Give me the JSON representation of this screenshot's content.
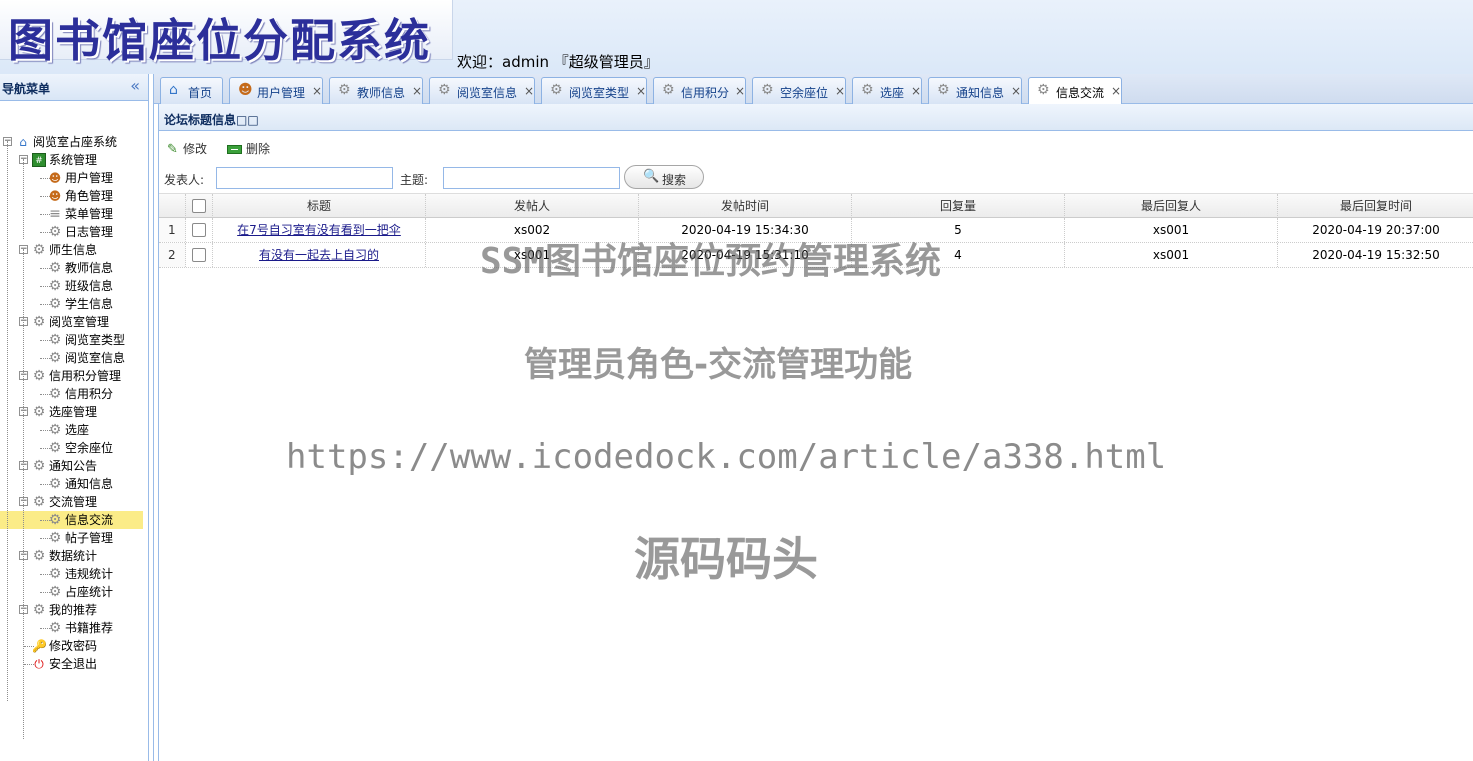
{
  "header": {
    "logo_text": "图书馆座位分配系统",
    "welcome": "欢迎：admin 『超级管理员』"
  },
  "sidebar": {
    "title": "导航菜单",
    "collapse_icon": "«",
    "tree": [
      {
        "label": "阅览室占座系统",
        "icon": "home-icon"
      },
      {
        "label": "系统管理",
        "icon": "grid-icon"
      },
      {
        "label": "用户管理",
        "icon": "user-icon"
      },
      {
        "label": "角色管理",
        "icon": "users-icon"
      },
      {
        "label": "菜单管理",
        "icon": "menu-icon"
      },
      {
        "label": "日志管理",
        "icon": "gear-icon"
      },
      {
        "label": "师生信息",
        "icon": "gear-icon"
      },
      {
        "label": "教师信息",
        "icon": "gear-icon"
      },
      {
        "label": "班级信息",
        "icon": "gear-icon"
      },
      {
        "label": "学生信息",
        "icon": "gear-icon"
      },
      {
        "label": "阅览室管理",
        "icon": "gear-icon"
      },
      {
        "label": "阅览室类型",
        "icon": "gear-icon"
      },
      {
        "label": "阅览室信息",
        "icon": "gear-icon"
      },
      {
        "label": "信用积分管理",
        "icon": "gear-icon"
      },
      {
        "label": "信用积分",
        "icon": "gear-icon"
      },
      {
        "label": "选座管理",
        "icon": "gear-icon"
      },
      {
        "label": "选座",
        "icon": "gear-icon"
      },
      {
        "label": "空余座位",
        "icon": "gear-icon"
      },
      {
        "label": "通知公告",
        "icon": "gear-icon"
      },
      {
        "label": "通知信息",
        "icon": "gear-icon"
      },
      {
        "label": "交流管理",
        "icon": "gear-icon"
      },
      {
        "label": "信息交流",
        "icon": "gear-icon"
      },
      {
        "label": "帖子管理",
        "icon": "gear-icon"
      },
      {
        "label": "数据统计",
        "icon": "gear-icon"
      },
      {
        "label": "违规统计",
        "icon": "gear-icon"
      },
      {
        "label": "占座统计",
        "icon": "gear-icon"
      },
      {
        "label": "我的推荐",
        "icon": "gear-icon"
      },
      {
        "label": "书籍推荐",
        "icon": "gear-icon"
      },
      {
        "label": "修改密码",
        "icon": "key-icon"
      },
      {
        "label": "安全退出",
        "icon": "exit-icon"
      }
    ]
  },
  "tabs": [
    {
      "label": "首页",
      "icon": "home-icon",
      "closable": false
    },
    {
      "label": "用户管理",
      "icon": "user-icon",
      "closable": true
    },
    {
      "label": "教师信息",
      "icon": "gear-icon",
      "closable": true
    },
    {
      "label": "阅览室信息",
      "icon": "gear-icon",
      "closable": true
    },
    {
      "label": "阅览室类型",
      "icon": "gear-icon",
      "closable": true
    },
    {
      "label": "信用积分",
      "icon": "gear-icon",
      "closable": true
    },
    {
      "label": "空余座位",
      "icon": "gear-icon",
      "closable": true
    },
    {
      "label": "选座",
      "icon": "gear-icon",
      "closable": true
    },
    {
      "label": "通知信息",
      "icon": "gear-icon",
      "closable": true
    },
    {
      "label": "信息交流",
      "icon": "gear-icon",
      "closable": true,
      "active": true
    }
  ],
  "close_glyph": "×",
  "panel": {
    "title": "论坛标题信息□□"
  },
  "toolbar": {
    "edit_label": "修改",
    "delete_label": "删除"
  },
  "search": {
    "poster_label": "发表人:",
    "poster_value": "",
    "subject_label": "主题:",
    "subject_value": "",
    "button_label": "搜索"
  },
  "grid": {
    "columns": [
      "标题",
      "发帖人",
      "发帖时间",
      "回复量",
      "最后回复人",
      "最后回复时间"
    ],
    "rows": [
      {
        "num": "1",
        "title": "在7号自习室有没有看到一把伞",
        "poster": "xs002",
        "post_time": "2020-04-19 15:34:30",
        "replies": "5",
        "last_replier": "xs001",
        "last_reply_time": "2020-04-19 20:37:00"
      },
      {
        "num": "2",
        "title": "有没有一起去上自习的",
        "poster": "xs001",
        "post_time": "2020-04-19 15:31:10",
        "replies": "4",
        "last_replier": "xs001",
        "last_reply_time": "2020-04-19 15:32:50"
      }
    ]
  },
  "watermarks": {
    "line1": "SSM图书馆座位预约管理系统",
    "line2": "管理员角色-交流管理功能",
    "line3": "https://www.icodedock.com/article/a338.html",
    "line4": "源码码头"
  }
}
